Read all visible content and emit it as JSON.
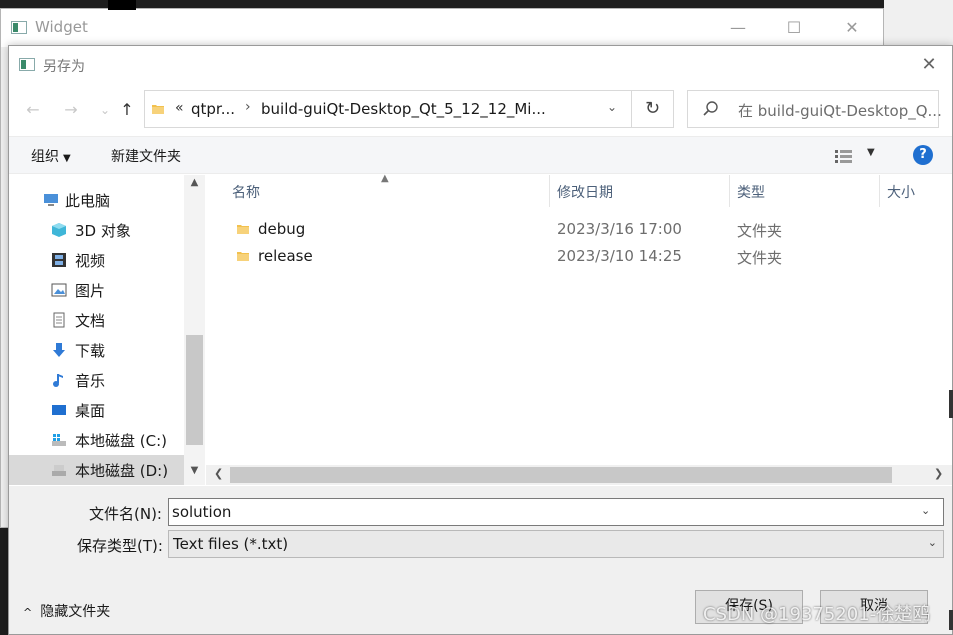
{
  "background_window": {
    "title": "Widget",
    "minimize": "—",
    "maximize": "☐",
    "close": "✕"
  },
  "dialog": {
    "title": "另存为",
    "close": "✕"
  },
  "nav": {
    "back": "←",
    "forward": "→",
    "recent": "⌄",
    "up": "↑"
  },
  "address": {
    "chevrons": "«",
    "crumbs": [
      "qtpr...",
      "build-guiQt-Desktop_Qt_5_12_12_Mi..."
    ],
    "separator": "›",
    "dropdown": "⌄",
    "refresh": "↻"
  },
  "search": {
    "placeholder": "在 build-guiQt-Desktop_Q..."
  },
  "toolbar": {
    "organize": "组织",
    "new_folder": "新建文件夹",
    "help": "?"
  },
  "tree": {
    "items": [
      {
        "label": "此电脑",
        "icon": "computer-icon"
      },
      {
        "label": "3D 对象",
        "icon": "cube-icon"
      },
      {
        "label": "视频",
        "icon": "film-icon"
      },
      {
        "label": "图片",
        "icon": "picture-icon"
      },
      {
        "label": "文档",
        "icon": "document-icon"
      },
      {
        "label": "下载",
        "icon": "download-icon"
      },
      {
        "label": "音乐",
        "icon": "music-icon"
      },
      {
        "label": "桌面",
        "icon": "desktop-icon"
      },
      {
        "label": "本地磁盘 (C:)",
        "icon": "system-drive-icon"
      },
      {
        "label": "本地磁盘 (D:)",
        "icon": "drive-icon"
      }
    ]
  },
  "file_list": {
    "columns": [
      "名称",
      "修改日期",
      "类型",
      "大小"
    ],
    "rows": [
      {
        "name": "debug",
        "modified": "2023/3/16 17:00",
        "type": "文件夹"
      },
      {
        "name": "release",
        "modified": "2023/3/10 14:25",
        "type": "文件夹"
      }
    ]
  },
  "form": {
    "filename_label": "文件名(N):",
    "filename_value": "solution",
    "filetype_label": "保存类型(T):",
    "filetype_value": "Text files (*.txt)",
    "hide_folders": "隐藏文件夹",
    "save": "保存(S)",
    "cancel": "取消"
  },
  "watermark": "CSDN @19375201-徐楚鸥",
  "colors": {
    "accent": "#1f6fd0",
    "folder": "#f2c14e",
    "selection": "#d9d9d9"
  }
}
